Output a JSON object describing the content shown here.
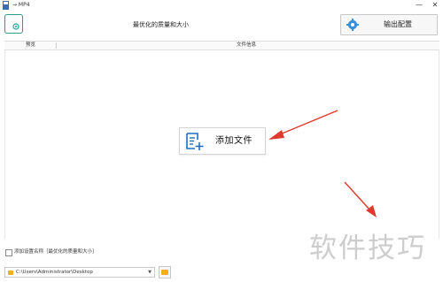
{
  "window": {
    "title": "→ MP4",
    "minimize": "—",
    "close": "✕"
  },
  "header": {
    "quality_text": "最优化的质量和大小",
    "output_button_label": "输出配置"
  },
  "list": {
    "columns": [
      "预览",
      "文件信息"
    ]
  },
  "main": {
    "add_file_label": "添加文件"
  },
  "footer": {
    "checkbox_label": "添加设置名称［最优化的质量和大小］",
    "output_path": "C:\\Users\\Administrator\\Desktop"
  },
  "watermark": "软件技巧",
  "colors": {
    "accent": "#2a9d8f",
    "icon_blue": "#1e6fbf",
    "arrow_red": "#e03a2f",
    "folder": "#f2b01e"
  }
}
